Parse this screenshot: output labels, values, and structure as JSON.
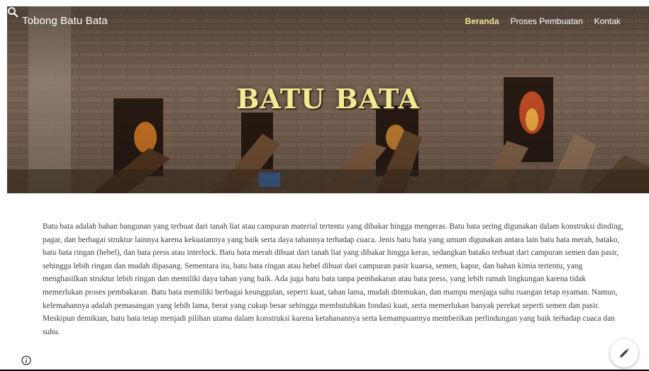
{
  "site": {
    "title": "Tobong Batu Bata"
  },
  "nav": {
    "items": [
      {
        "label": "Beranda",
        "active": true
      },
      {
        "label": "Proses Pembuatan",
        "active": false
      },
      {
        "label": "Kontak",
        "active": false
      }
    ],
    "search_icon": "search-icon"
  },
  "hero": {
    "title": "BATU BATA"
  },
  "content": {
    "paragraph": "Batu bata adalah bahan bangunan yang terbuat dari tanah liat atau campuran material tertentu yang dibakar hingga mengeras. Batu bata sering digunakan dalam konstruksi dinding, pagar, dan berbagai struktur lainnya karena kekuatannya yang baik serta daya tahannya terhadap cuaca. Jenis batu bata yang umum digunakan antara lain batu bata merah, batako, batu bata ringan (hebel), dan bata press atau interlock. Batu bata merah dibuat dari tanah liat yang dibakar hingga keras, sedangkan batako terbuat dari campuran semen dan pasir, sehingga lebih ringan dan mudah dipasang. Sementara itu, batu bata ringan atau hebel dibuat dari campuran pasir kuarsa, semen, kapur, dan bahan kimia tertentu, yang menghasilkan struktur lebih ringan dan memiliki daya tahan yang baik. Ada juga batu bata tanpa pembakaran atau bata press, yang lebih ramah lingkungan karena tidak memerlukan proses pembakaran. Batu bata memiliki berbagai keunggulan, seperti kuat, tahan lama, mudah ditemukan, dan mampu menjaga suhu ruangan tetap nyaman. Namun, kelemahannya adalah pemasangan yang lebih lama, berat yang cukup besar sehingga membutuhkan fondasi kuat, serta memerlukan banyak perekat seperti semen dan pasir. Meskipun demikian, batu bata tetap menjadi pilihan utama dalam konstruksi karena ketahanannya serta kemampuannya memberikan perlindungan yang baik terhadap cuaca dan suhu."
  },
  "footer": {
    "info_icon": "info-icon",
    "edit_icon": "pencil-icon"
  },
  "colors": {
    "active_nav": "#f2e58f",
    "hero_title": "#f4ea94",
    "text": "#3c3c3c"
  }
}
